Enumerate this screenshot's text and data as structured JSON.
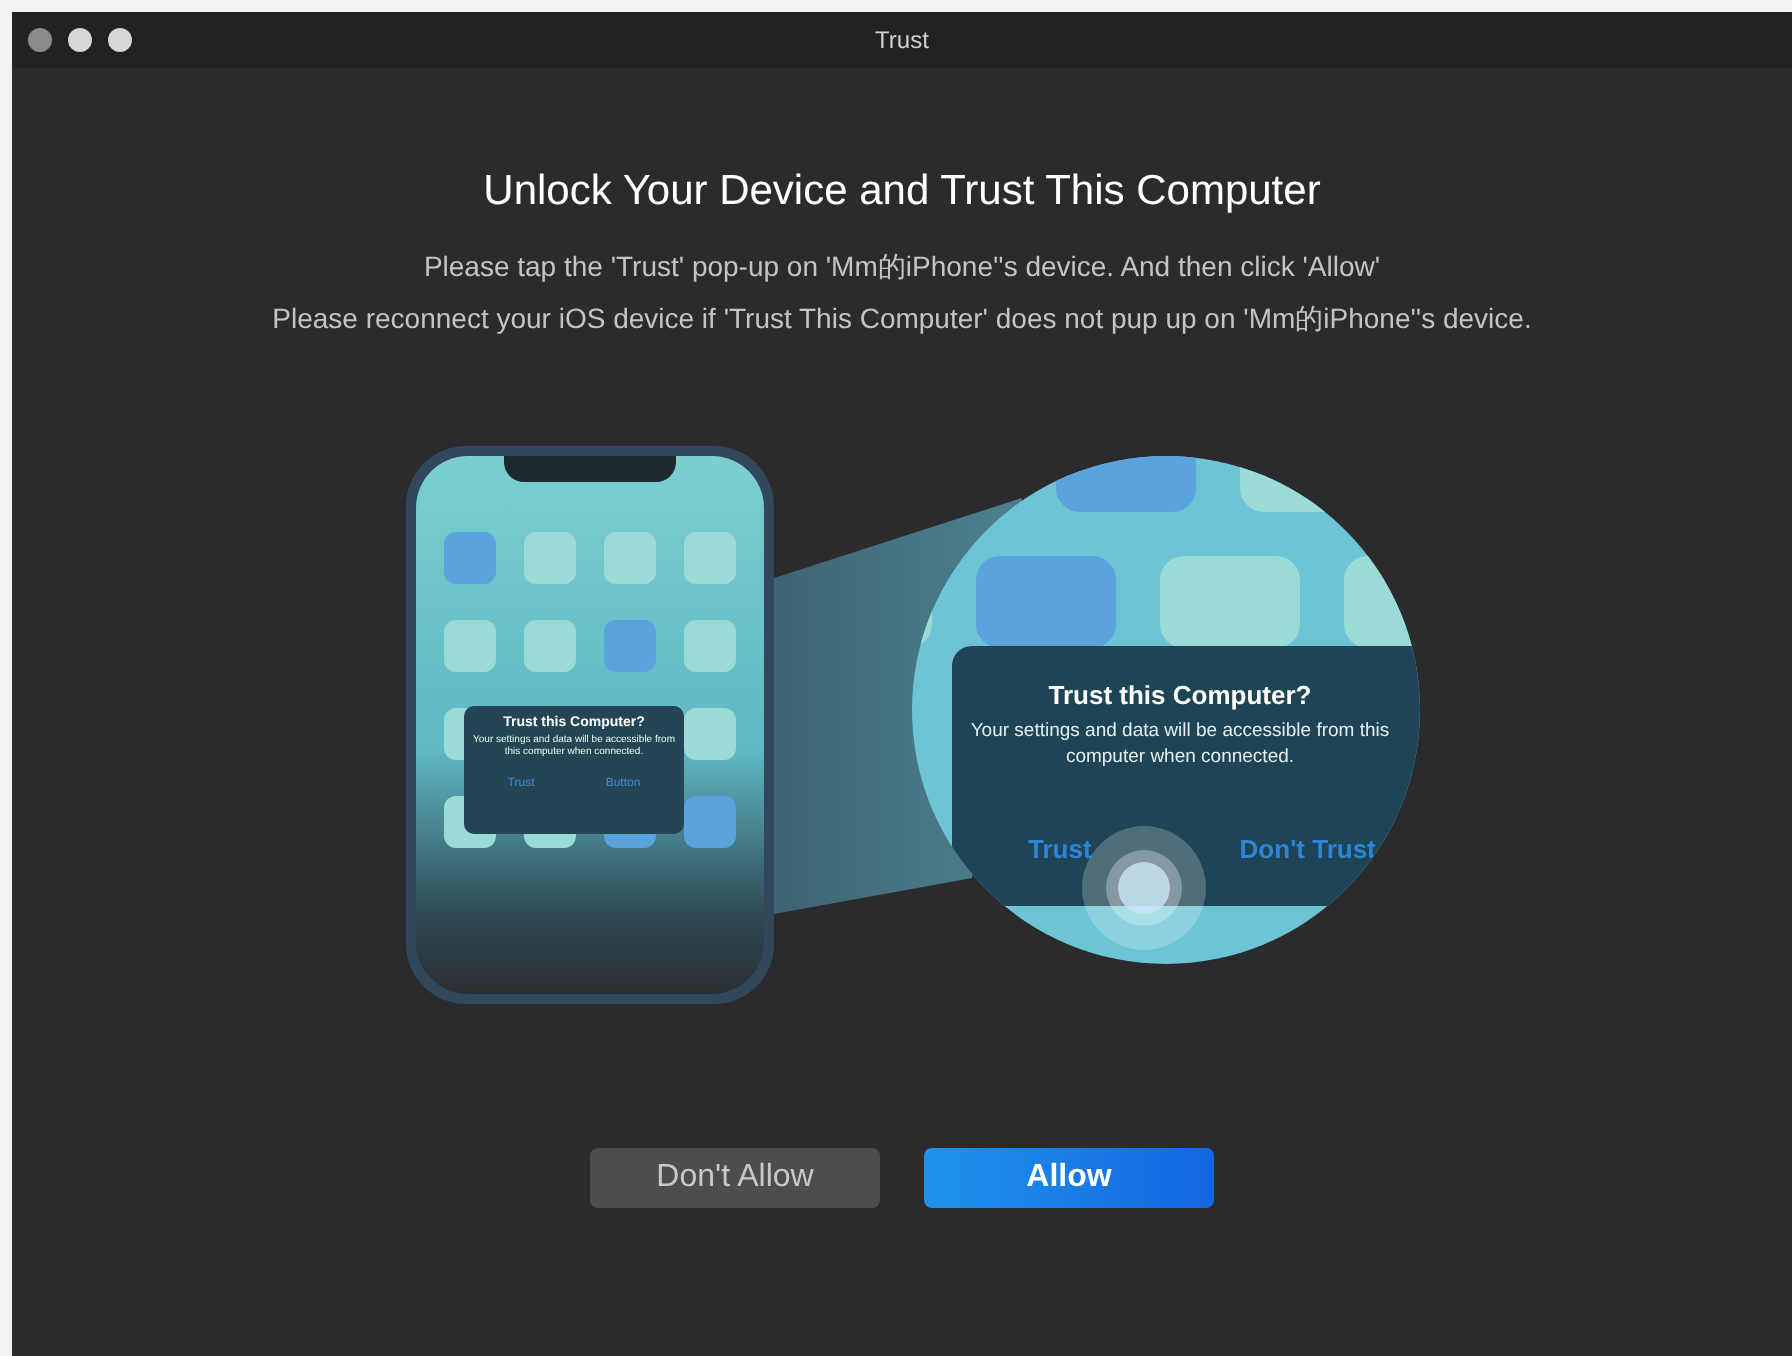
{
  "window": {
    "title": "Trust"
  },
  "heading": "Unlock Your Device and Trust This Computer",
  "instructions": [
    "Please tap the 'Trust' pop-up on 'Mm的iPhone''s device. And then click 'Allow'",
    "Please reconnect your iOS device if 'Trust This Computer' does not pup up on 'Mm的iPhone''s device."
  ],
  "phone_dialog": {
    "title": "Trust this Computer?",
    "message": "Your settings and data will be accessible from this computer when connected.",
    "buttons": [
      "Trust",
      "Button"
    ]
  },
  "magnified_dialog": {
    "title": "Trust this Computer?",
    "message": "Your settings and data will be accessible from this computer when connected.",
    "buttons": [
      "Trust",
      "Don't Trust"
    ]
  },
  "buttons": [
    {
      "label": "Don't Allow",
      "kind": "secondary"
    },
    {
      "label": "Allow",
      "kind": "primary"
    }
  ]
}
